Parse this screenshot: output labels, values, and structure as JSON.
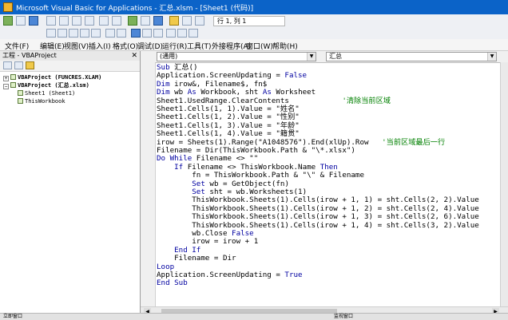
{
  "window": {
    "title": "Microsoft Visual Basic for Applications - 汇总.xlsm - [Sheet1 (代码)]"
  },
  "toolbar": {
    "position": "行 1, 列 1"
  },
  "menu": [
    "文件(F)",
    "编辑(E)",
    "视图(V)",
    "插入(I)",
    "格式(O)",
    "调试(D)",
    "运行(R)",
    "工具(T)",
    "外接程序(A)",
    "窗口(W)",
    "帮助(H)"
  ],
  "project": {
    "title": "工程 - VBAProject",
    "nodes": [
      {
        "label": "VBAProject (FUNCRES.XLAM)"
      },
      {
        "label": "VBAProject (汇总.xlsm)"
      },
      {
        "label": "Sheet1 (Sheet1)"
      },
      {
        "label": "ThisWorkbook"
      }
    ]
  },
  "editor": {
    "object_combo": "(通用)",
    "proc_combo": "汇总",
    "lines": [
      [
        [
          "kw",
          "Sub "
        ],
        [
          "",
          "汇总()"
        ]
      ],
      [
        [
          "",
          "Application.ScreenUpdating = "
        ],
        [
          "kw",
          "False"
        ]
      ],
      [
        [
          "kw",
          "Dim "
        ],
        [
          "",
          "irow&, Filename$, fn$"
        ]
      ],
      [
        [
          "kw",
          "Dim "
        ],
        [
          "",
          "wb "
        ],
        [
          "kw",
          "As "
        ],
        [
          "",
          "Workbook, sht "
        ],
        [
          "kw",
          "As "
        ],
        [
          "",
          "Worksheet"
        ]
      ],
      [
        [
          "",
          "Sheet1.UsedRange.ClearContents            "
        ],
        [
          "cm",
          "'清除当前区域"
        ]
      ],
      [
        [
          "",
          "Sheet1.Cells(1, 1).Value = \"姓名\""
        ]
      ],
      [
        [
          "",
          "Sheet1.Cells(1, 2).Value = \"性别\""
        ]
      ],
      [
        [
          "",
          "Sheet1.Cells(1, 3).Value = \"年龄\""
        ]
      ],
      [
        [
          "",
          "Sheet1.Cells(1, 4).Value = \"籍贯\""
        ]
      ],
      [
        [
          "",
          "irow = Sheets(1).Range(\"A1048576\").End(xlUp).Row   "
        ],
        [
          "cm",
          "'当前区域最后一行"
        ]
      ],
      [
        [
          "",
          "Filename = Dir(ThisWorkbook.Path & \"\\*.xlsx\")"
        ]
      ],
      [
        [
          "kw",
          "Do While "
        ],
        [
          "",
          "Filename <> \"\""
        ]
      ],
      [
        [
          "",
          "    "
        ],
        [
          "kw",
          "If "
        ],
        [
          "",
          "Filename <> ThisWorkbook.Name "
        ],
        [
          "kw",
          "Then"
        ]
      ],
      [
        [
          "",
          "        fn = ThisWorkbook.Path & \"\\\" & Filename"
        ]
      ],
      [
        [
          "",
          "        "
        ],
        [
          "kw",
          "Set "
        ],
        [
          "",
          "wb = GetObject(fn)"
        ]
      ],
      [
        [
          "",
          "        "
        ],
        [
          "kw",
          "Set "
        ],
        [
          "",
          "sht = wb.Worksheets(1)"
        ]
      ],
      [
        [
          "",
          "        ThisWorkbook.Sheets(1).Cells(irow + 1, 1) = sht.Cells(2, 2).Value"
        ]
      ],
      [
        [
          "",
          "        ThisWorkbook.Sheets(1).Cells(irow + 1, 2) = sht.Cells(2, 4).Value"
        ]
      ],
      [
        [
          "",
          "        ThisWorkbook.Sheets(1).Cells(irow + 1, 3) = sht.Cells(2, 6).Value"
        ]
      ],
      [
        [
          "",
          "        ThisWorkbook.Sheets(1).Cells(irow + 1, 4) = sht.Cells(3, 2).Value"
        ]
      ],
      [
        [
          "",
          "        wb.Close "
        ],
        [
          "kw",
          "False"
        ]
      ],
      [
        [
          "",
          "        irow = irow + 1"
        ]
      ],
      [
        [
          "",
          "    "
        ],
        [
          "kw",
          "End If"
        ]
      ],
      [
        [
          "",
          "    Filename = Dir"
        ]
      ],
      [
        [
          "kw",
          "Loop"
        ]
      ],
      [
        [
          "",
          "Application.ScreenUpdating = "
        ],
        [
          "kw",
          "True"
        ]
      ],
      [
        [
          "kw",
          "End Sub"
        ]
      ]
    ]
  },
  "statusbar": {
    "left": "立即窗口",
    "right": "监视窗口"
  },
  "colors": {
    "title_bg": "#0b63c8",
    "keyword": "#0000a0",
    "comment": "#008000"
  }
}
